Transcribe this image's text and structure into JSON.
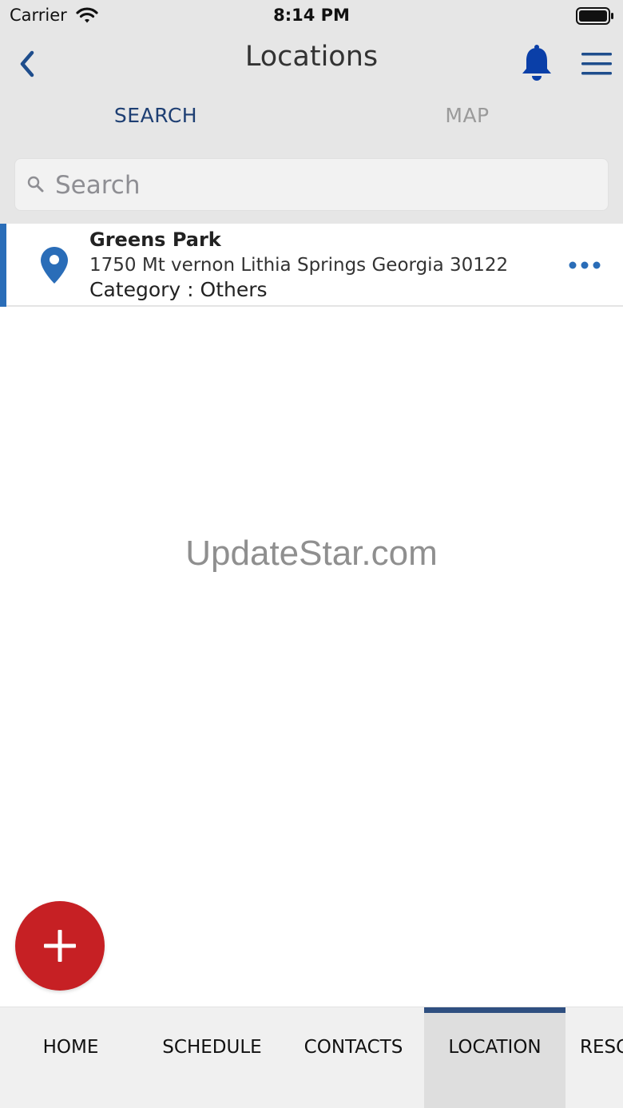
{
  "status_bar": {
    "carrier": "Carrier",
    "time": "8:14 PM"
  },
  "nav": {
    "title": "Locations",
    "back_icon": "chevron-left-icon",
    "notification_icon": "bell-icon",
    "menu_icon": "hamburger-menu-icon"
  },
  "tabs": [
    {
      "label": "SEARCH",
      "active": true
    },
    {
      "label": "MAP",
      "active": false
    }
  ],
  "search": {
    "placeholder": "Search",
    "value": ""
  },
  "locations": [
    {
      "name": "Greens Park",
      "address": "1750 Mt vernon Lithia Springs Georgia 30122",
      "category": "Category : Others"
    }
  ],
  "watermark": "UpdateStar.com",
  "fab": {
    "icon": "plus-icon"
  },
  "bottom_nav": [
    {
      "label": "HOME",
      "active": false
    },
    {
      "label": "SCHEDULE",
      "active": false
    },
    {
      "label": "CONTACTS",
      "active": false
    },
    {
      "label": "LOCATION",
      "active": true
    },
    {
      "label": "RESOURCES",
      "active": false
    }
  ],
  "colors": {
    "primary_blue": "#1e3f73",
    "accent_blue": "#2a6db8",
    "fab_red": "#c62024",
    "header_bg": "#e6e6e6"
  }
}
